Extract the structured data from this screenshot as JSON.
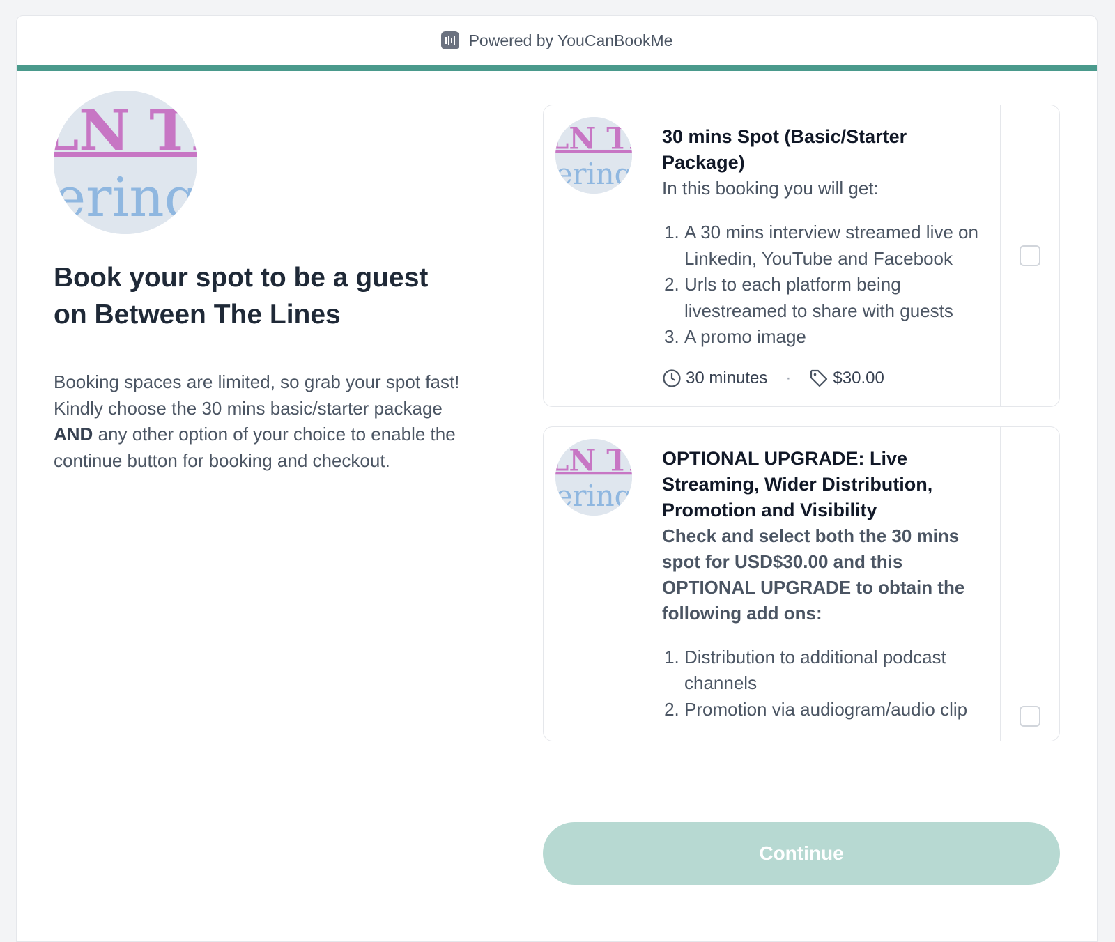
{
  "header": {
    "powered_by": "Powered by YouCanBookMe"
  },
  "profile": {
    "title": "Book your spot to be a guest on Between The Lines",
    "description_line1": "Booking spaces are limited, so grab your spot fast!",
    "description_line2_pre": "Kindly choose the 30 mins basic/starter package ",
    "description_line2_bold": "AND",
    "description_line2_post": " any other option of your choice to enable the continue button for booking and checkout."
  },
  "cards": [
    {
      "title": "30 mins Spot (Basic/Starter Package)",
      "subtitle": "In this booking you will get:",
      "items": [
        "A 30 mins interview streamed live on Linkedin, YouTube and Facebook",
        "Urls to each platform being livestreamed to share with guests",
        "A promo image"
      ],
      "duration": "30 minutes",
      "price": "$30.00",
      "checked": false
    },
    {
      "title": "OPTIONAL UPGRADE: Live Streaming, Wider Distribution, Promotion and Visibility",
      "subtitle": "Check and select both the 30 mins spot for USD$30.00 and this OPTIONAL UPGRADE to obtain the following add ons:",
      "items": [
        "Distribution to additional podcast channels",
        "Promotion via audiogram/audio clip"
      ],
      "checked": false
    }
  ],
  "continue_label": "Continue",
  "colors": {
    "accent": "#4a9a8c",
    "continue_disabled": "#b7d9d2"
  }
}
